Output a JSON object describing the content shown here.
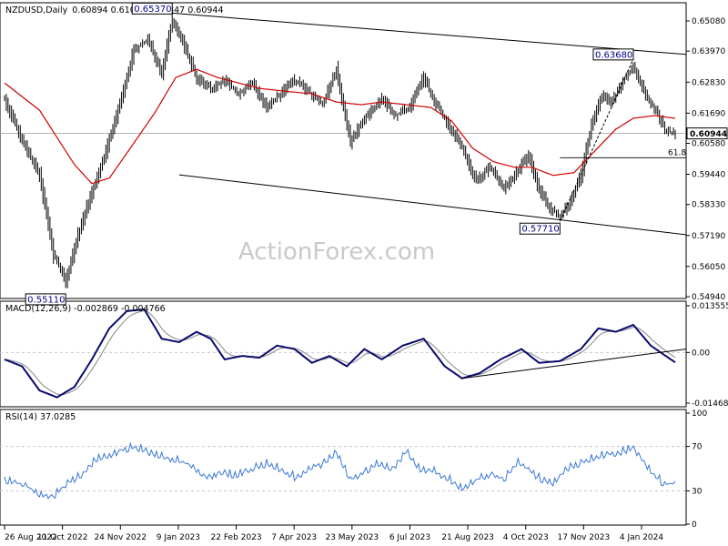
{
  "chart_data": {
    "type": "candlestick",
    "symbol_header": "NZDUSD,Daily",
    "ohlc_header": "0.60894 0.61069 0.60847 0.60944",
    "watermark": "ActionForex.com",
    "colors": {
      "price": "#000000",
      "sma": "#d00000",
      "macd": "#0a0a6e",
      "signal": "#888888",
      "rsi": "#3a78d6",
      "grid": "#c8c8c8"
    },
    "x_ticks": [
      "26 Aug 2022",
      "11 Oct 2022",
      "24 Nov 2022",
      "9 Jan 2023",
      "22 Feb 2023",
      "7 Apr 2023",
      "23 May 2023",
      "6 Jul 2023",
      "21 Aug 2023",
      "4 Oct 2023",
      "17 Nov 2023",
      "4 Jan 2024"
    ],
    "price_panel": {
      "y_ticks": [
        "0.65080",
        "0.63970",
        "0.62830",
        "0.61690",
        "0.60580",
        "0.59440",
        "0.58330",
        "0.57190",
        "0.56050",
        "0.54940"
      ],
      "ylim": [
        0.5494,
        0.6565
      ],
      "current_price": "0.60944",
      "current_value": 0.60944,
      "fib_label": "61.8",
      "fib_value": 0.6005,
      "annotations": [
        {
          "text": "0.65370",
          "value": 0.6537,
          "date_index": 96
        },
        {
          "text": "0.63680",
          "value": 0.6368,
          "date_index": 360
        },
        {
          "text": "0.57710",
          "value": 0.5771,
          "date_index": 318
        },
        {
          "text": "0.55110",
          "value": 0.5511,
          "date_index": 35
        }
      ],
      "close_anchors": [
        [
          0,
          0.622
        ],
        [
          10,
          0.607
        ],
        [
          20,
          0.594
        ],
        [
          28,
          0.565
        ],
        [
          35,
          0.555
        ],
        [
          42,
          0.572
        ],
        [
          50,
          0.588
        ],
        [
          58,
          0.603
        ],
        [
          66,
          0.62
        ],
        [
          74,
          0.64
        ],
        [
          82,
          0.644
        ],
        [
          90,
          0.632
        ],
        [
          96,
          0.651
        ],
        [
          102,
          0.643
        ],
        [
          110,
          0.63
        ],
        [
          118,
          0.626
        ],
        [
          126,
          0.629
        ],
        [
          134,
          0.624
        ],
        [
          142,
          0.628
        ],
        [
          150,
          0.619
        ],
        [
          158,
          0.624
        ],
        [
          166,
          0.629
        ],
        [
          174,
          0.625
        ],
        [
          182,
          0.62
        ],
        [
          190,
          0.633
        ],
        [
          198,
          0.606
        ],
        [
          204,
          0.613
        ],
        [
          210,
          0.618
        ],
        [
          216,
          0.622
        ],
        [
          224,
          0.616
        ],
        [
          232,
          0.619
        ],
        [
          240,
          0.63
        ],
        [
          246,
          0.621
        ],
        [
          254,
          0.613
        ],
        [
          262,
          0.604
        ],
        [
          270,
          0.592
        ],
        [
          278,
          0.597
        ],
        [
          286,
          0.589
        ],
        [
          294,
          0.596
        ],
        [
          300,
          0.601
        ],
        [
          306,
          0.589
        ],
        [
          312,
          0.582
        ],
        [
          318,
          0.579
        ],
        [
          324,
          0.584
        ],
        [
          330,
          0.594
        ],
        [
          336,
          0.612
        ],
        [
          342,
          0.623
        ],
        [
          348,
          0.621
        ],
        [
          354,
          0.629
        ],
        [
          360,
          0.634
        ],
        [
          366,
          0.625
        ],
        [
          372,
          0.619
        ],
        [
          378,
          0.611
        ],
        [
          384,
          0.609
        ]
      ],
      "sma_anchors": [
        [
          0,
          0.628
        ],
        [
          20,
          0.618
        ],
        [
          40,
          0.598
        ],
        [
          50,
          0.591
        ],
        [
          60,
          0.593
        ],
        [
          72,
          0.604
        ],
        [
          86,
          0.617
        ],
        [
          98,
          0.63
        ],
        [
          110,
          0.633
        ],
        [
          122,
          0.63
        ],
        [
          134,
          0.628
        ],
        [
          146,
          0.626
        ],
        [
          160,
          0.625
        ],
        [
          176,
          0.624
        ],
        [
          190,
          0.621
        ],
        [
          204,
          0.62
        ],
        [
          216,
          0.621
        ],
        [
          230,
          0.62
        ],
        [
          244,
          0.619
        ],
        [
          256,
          0.614
        ],
        [
          268,
          0.604
        ],
        [
          280,
          0.599
        ],
        [
          292,
          0.597
        ],
        [
          302,
          0.597
        ],
        [
          314,
          0.594
        ],
        [
          326,
          0.595
        ],
        [
          338,
          0.603
        ],
        [
          350,
          0.611
        ],
        [
          360,
          0.615
        ],
        [
          372,
          0.616
        ],
        [
          384,
          0.615
        ]
      ],
      "trendlines": [
        {
          "from": [
            96,
            0.6537
          ],
          "to": [
            390,
            0.6385
          ]
        },
        {
          "from": [
            100,
            0.5942
          ],
          "to": [
            390,
            0.5722
          ]
        },
        {
          "from": [
            318,
            0.5771
          ],
          "to": [
            360,
            0.6368
          ],
          "style": "dashed"
        },
        {
          "from": [
            318,
            0.6005
          ],
          "to": [
            390,
            0.6005
          ],
          "style": "fib"
        }
      ]
    },
    "macd_panel": {
      "label": "MACD(12,26,9) -0.002869 -0.004766",
      "y_ticks": [
        "0.013555",
        "0.00",
        "-0.014684"
      ],
      "ylim": [
        -0.014684,
        0.013555
      ],
      "macd_anchors": [
        [
          0,
          -0.002
        ],
        [
          10,
          -0.004
        ],
        [
          20,
          -0.011
        ],
        [
          30,
          -0.013
        ],
        [
          40,
          -0.01
        ],
        [
          50,
          -0.002
        ],
        [
          60,
          0.007
        ],
        [
          70,
          0.012
        ],
        [
          80,
          0.0125
        ],
        [
          90,
          0.004
        ],
        [
          100,
          0.003
        ],
        [
          110,
          0.006
        ],
        [
          118,
          0.004
        ],
        [
          126,
          -0.002
        ],
        [
          136,
          -0.001
        ],
        [
          146,
          -0.0015
        ],
        [
          156,
          0.002
        ],
        [
          166,
          0.001
        ],
        [
          176,
          -0.003
        ],
        [
          186,
          -0.001
        ],
        [
          196,
          -0.004
        ],
        [
          206,
          0.001
        ],
        [
          216,
          -0.002
        ],
        [
          228,
          0.002
        ],
        [
          240,
          0.004
        ],
        [
          252,
          -0.004
        ],
        [
          262,
          -0.0075
        ],
        [
          272,
          -0.006
        ],
        [
          284,
          -0.002
        ],
        [
          296,
          0.001
        ],
        [
          306,
          -0.003
        ],
        [
          318,
          -0.0025
        ],
        [
          330,
          0.001
        ],
        [
          340,
          0.007
        ],
        [
          350,
          0.006
        ],
        [
          360,
          0.008
        ],
        [
          370,
          0.002
        ],
        [
          380,
          -0.0015
        ],
        [
          384,
          -0.002869
        ]
      ],
      "trendline": {
        "from": [
          262,
          -0.0075
        ],
        "to": [
          390,
          0.001
        ]
      }
    },
    "rsi_panel": {
      "label": "RSI(14) 37.0285",
      "y_ticks": [
        "100",
        "70",
        "30",
        "0"
      ],
      "ylim": [
        0,
        100
      ],
      "levels": [
        70,
        30
      ],
      "rsi_anchors": [
        [
          0,
          40
        ],
        [
          10,
          36
        ],
        [
          20,
          28
        ],
        [
          28,
          25
        ],
        [
          36,
          38
        ],
        [
          44,
          44
        ],
        [
          52,
          58
        ],
        [
          60,
          62
        ],
        [
          68,
          68
        ],
        [
          76,
          70
        ],
        [
          84,
          64
        ],
        [
          92,
          60
        ],
        [
          100,
          58
        ],
        [
          108,
          52
        ],
        [
          116,
          42
        ],
        [
          124,
          48
        ],
        [
          132,
          45
        ],
        [
          142,
          50
        ],
        [
          150,
          55
        ],
        [
          158,
          50
        ],
        [
          166,
          43
        ],
        [
          174,
          50
        ],
        [
          182,
          55
        ],
        [
          190,
          65
        ],
        [
          198,
          40
        ],
        [
          206,
          48
        ],
        [
          214,
          55
        ],
        [
          222,
          50
        ],
        [
          230,
          66
        ],
        [
          238,
          50
        ],
        [
          246,
          48
        ],
        [
          254,
          42
        ],
        [
          262,
          33
        ],
        [
          270,
          40
        ],
        [
          278,
          46
        ],
        [
          286,
          41
        ],
        [
          294,
          58
        ],
        [
          300,
          50
        ],
        [
          306,
          42
        ],
        [
          314,
          38
        ],
        [
          322,
          50
        ],
        [
          330,
          56
        ],
        [
          338,
          60
        ],
        [
          346,
          64
        ],
        [
          354,
          66
        ],
        [
          360,
          70
        ],
        [
          366,
          57
        ],
        [
          372,
          45
        ],
        [
          378,
          36
        ],
        [
          384,
          37.03
        ]
      ]
    }
  }
}
